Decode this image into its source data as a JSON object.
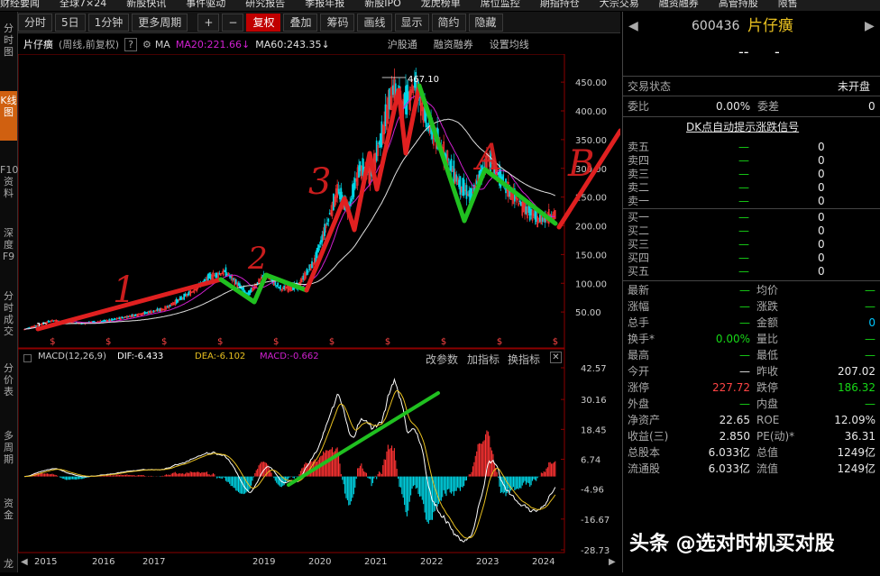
{
  "top_menu": [
    "财经要闻",
    "全球7×24",
    "新股快讯",
    "事件驱动",
    "研究报告",
    "季报年报",
    "新股IPO",
    "龙虎榜单",
    "席位监控",
    "期指持仓",
    "大宗交易",
    "融资融券",
    "高管持股",
    "限售"
  ],
  "toolbar": {
    "period_tabs": [
      "分时",
      "5日",
      "1分钟",
      "更多周期"
    ],
    "zoom_in": "+",
    "zoom_out": "−",
    "items": [
      "复权",
      "叠加",
      "筹码",
      "画线",
      "显示",
      "简约",
      "隐藏"
    ]
  },
  "left_nav": [
    "分时图",
    "K线图",
    "F10资料",
    "深度F9",
    "分时成交",
    "分价表",
    "多周期",
    "资金",
    "龙"
  ],
  "chart_header": {
    "name": "片仔癀",
    "mode": "(周线,前复权)",
    "ma_label": "MA",
    "ma20": "MA20:221.66",
    "ma60": "MA60:243.35",
    "links": [
      "沪股通",
      "融资融券",
      "设置均线"
    ]
  },
  "price_axis": [
    "450.00",
    "400.00",
    "350.00",
    "300.00",
    "250.00",
    "200.00",
    "150.00",
    "100.00",
    "50.00"
  ],
  "high_label": "467.10",
  "low_label": "13",
  "macd_header": {
    "name": "MACD(12,26,9)",
    "dif": "DIF:-6.433",
    "dea": "DEA:-6.102",
    "macd": "MACD:-0.662",
    "links": [
      "改参数",
      "加指标",
      "换指标"
    ]
  },
  "macd_axis": [
    "42.57",
    "30.16",
    "18.45",
    "6.74",
    "-4.96",
    "-16.67",
    "-28.73"
  ],
  "years": [
    "2015",
    "2016",
    "2017",
    "2019",
    "2020",
    "2021",
    "2022",
    "2023",
    "2024"
  ],
  "annotations": [
    "1",
    "2",
    "3",
    "A",
    "B",
    "C"
  ],
  "quote": {
    "code": "600436",
    "name": "片仔癀",
    "dash1": "--",
    "dash2": "-",
    "trade_status_label": "交易状态",
    "trade_status": "未开盘",
    "weibi_label": "委比",
    "weibi": "0.00%",
    "weicha_label": "委差",
    "weicha": "0",
    "signal": "DK点自动提示涨跌信号",
    "asks": [
      {
        "label": "卖五",
        "price": "—",
        "vol": "0"
      },
      {
        "label": "卖四",
        "price": "—",
        "vol": "0"
      },
      {
        "label": "卖三",
        "price": "—",
        "vol": "0"
      },
      {
        "label": "卖二",
        "price": "—",
        "vol": "0"
      },
      {
        "label": "卖一",
        "price": "—",
        "vol": "0"
      }
    ],
    "bids": [
      {
        "label": "买一",
        "price": "—",
        "vol": "0"
      },
      {
        "label": "买二",
        "price": "—",
        "vol": "0"
      },
      {
        "label": "买三",
        "price": "—",
        "vol": "0"
      },
      {
        "label": "买四",
        "price": "—",
        "vol": "0"
      },
      {
        "label": "买五",
        "price": "—",
        "vol": "0"
      }
    ],
    "stats": [
      {
        "l1": "最新",
        "v1": "—",
        "l2": "均价",
        "v2": "—"
      },
      {
        "l1": "涨幅",
        "v1": "—",
        "l2": "涨跌",
        "v2": "—"
      },
      {
        "l1": "总手",
        "v1": "—",
        "l2": "金额",
        "v2": "0"
      },
      {
        "l1": "换手*",
        "v1": "0.00%",
        "l2": "量比",
        "v2": "—"
      },
      {
        "l1": "最高",
        "v1": "—",
        "l2": "最低",
        "v2": "—"
      },
      {
        "l1": "今开",
        "v1": "—",
        "l2": "昨收",
        "v2": "207.02"
      },
      {
        "l1": "涨停",
        "v1": "227.72",
        "l2": "跌停",
        "v2": "186.32"
      },
      {
        "l1": "外盘",
        "v1": "—",
        "l2": "内盘",
        "v2": "—"
      },
      {
        "l1": "净资产",
        "v1": "22.65",
        "l2": "ROE",
        "v2": "12.09%"
      },
      {
        "l1": "收益(三)",
        "v1": "2.850",
        "l2": "PE(动)*",
        "v2": "36.31"
      },
      {
        "l1": "总股本",
        "v1": "6.033亿",
        "l2": "总值",
        "v2": "1249亿"
      },
      {
        "l1": "流通股",
        "v1": "6.033亿",
        "l2": "流值",
        "v2": "1249亿"
      }
    ]
  },
  "watermark": "头条 @选对时机买对股",
  "colors": {
    "up": "#ff3333",
    "down": "#00d8e8",
    "ma20": "#d020d0",
    "ma60": "#e0e0e0",
    "accent": "#c00000",
    "annot_red": "#e02020",
    "annot_green": "#20c020"
  },
  "chart_data": {
    "type": "line",
    "title": "片仔癀 (周线,前复权)",
    "x_labels": [
      "2015",
      "2016",
      "2017",
      "2019",
      "2020",
      "2021",
      "2022",
      "2023",
      "2024"
    ],
    "price_ylim": [
      0,
      480
    ],
    "price_series": {
      "name": "片仔癀",
      "x": [
        2015.0,
        2015.5,
        2016.0,
        2016.5,
        2017.0,
        2017.5,
        2018.0,
        2018.3,
        2018.6,
        2019.0,
        2019.3,
        2019.6,
        2019.9,
        2020.2,
        2020.4,
        2020.6,
        2020.8,
        2021.0,
        2021.2,
        2021.4,
        2021.6,
        2021.8,
        2022.0,
        2022.2,
        2022.5,
        2022.8,
        2023.0,
        2023.3,
        2023.6,
        2023.9,
        2024.2,
        2024.5
      ],
      "y": [
        20,
        35,
        30,
        35,
        45,
        55,
        85,
        110,
        120,
        80,
        115,
        90,
        95,
        140,
        200,
        260,
        230,
        300,
        290,
        360,
        440,
        410,
        450,
        380,
        330,
        270,
        250,
        320,
        270,
        235,
        210,
        220
      ]
    },
    "macd_ylim": [
      -28.73,
      42.57
    ],
    "macd_ticks": [
      42.57,
      30.16,
      18.45,
      6.74,
      -4.96,
      -16.67,
      -28.73
    ],
    "dif": -6.433,
    "dea": -6.102,
    "macd": -0.662,
    "ma20": 221.66,
    "ma60": 243.35,
    "high": 467.1
  }
}
